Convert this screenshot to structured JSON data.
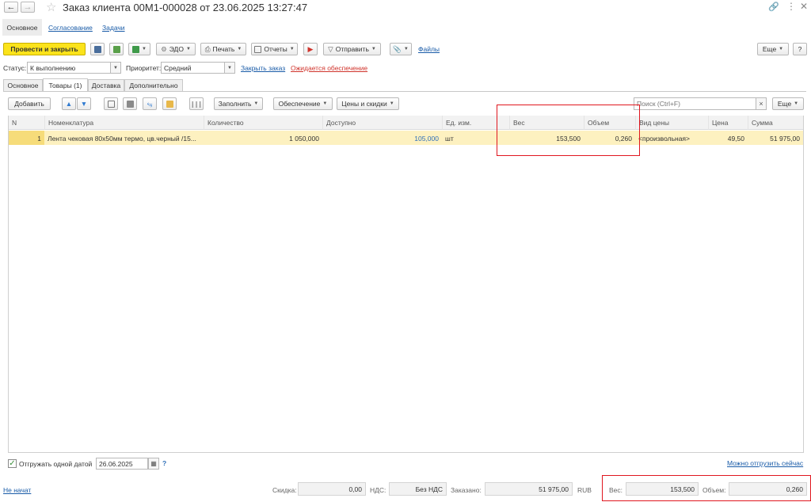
{
  "window": {
    "title": "Заказ клиента 00М1-000028 от 23.06.2025 13:27:47"
  },
  "top_tabs": [
    "Основное",
    "Согласование",
    "Задачи"
  ],
  "toolbar": {
    "post_close": "Провести и закрыть",
    "edo": "ЭДО",
    "print": "Печать",
    "reports": "Отчеты",
    "send": "Отправить",
    "files": "Файлы",
    "more": "Еще",
    "help": "?"
  },
  "status": {
    "label": "Статус:",
    "value": "К выполнению",
    "priority_label": "Приоритет:",
    "priority_value": "Средний",
    "close_order": "Закрыть заказ",
    "awaiting": "Ожидается обеспечение"
  },
  "inner_tabs": [
    "Основное",
    "Товары (1)",
    "Доставка",
    "Дополнительно"
  ],
  "grid_toolbar": {
    "add": "Добавить",
    "fill": "Заполнить",
    "provision": "Обеспечение",
    "prices": "Цены и скидки",
    "search_placeholder": "Поиск (Ctrl+F)",
    "clear": "×",
    "more": "Еще"
  },
  "table": {
    "columns": [
      "N",
      "Номенклатура",
      "Количество",
      "Доступно",
      "Ед. изм.",
      "Вес",
      "Объем",
      "Вид цены",
      "Цена",
      "Сумма"
    ],
    "rows": [
      {
        "n": "1",
        "item": "Лента чековая 80х50мм термо, цв.черный /15...",
        "qty": "1 050,000",
        "available": "105,000",
        "unit": "шт",
        "weight": "153,500",
        "volume": "0,260",
        "price_type": "<произвольная>",
        "price": "49,50",
        "sum": "51 975,00"
      }
    ]
  },
  "bottom": {
    "ship_one_date_label": "Отгружать одной датой",
    "ship_date": "26.06.2025",
    "help": "?",
    "can_ship_now": "Можно отгрузить сейчас"
  },
  "footer": {
    "not_started": "Не начат",
    "discount_label": "Скидка:",
    "discount_value": "0,00",
    "vat_label": "НДС:",
    "vat_value": "Без НДС",
    "ordered_label": "Заказано:",
    "ordered_value": "51 975,00",
    "currency": "RUB",
    "weight_label": "Вес:",
    "weight_value": "153,500",
    "volume_label": "Объем:",
    "volume_value": "0,260"
  },
  "colors": {
    "primary_button": "#fbe31b",
    "selected_row": "#fdf1c0",
    "highlight_box": "#e0171f",
    "link": "#1a5ca8"
  }
}
